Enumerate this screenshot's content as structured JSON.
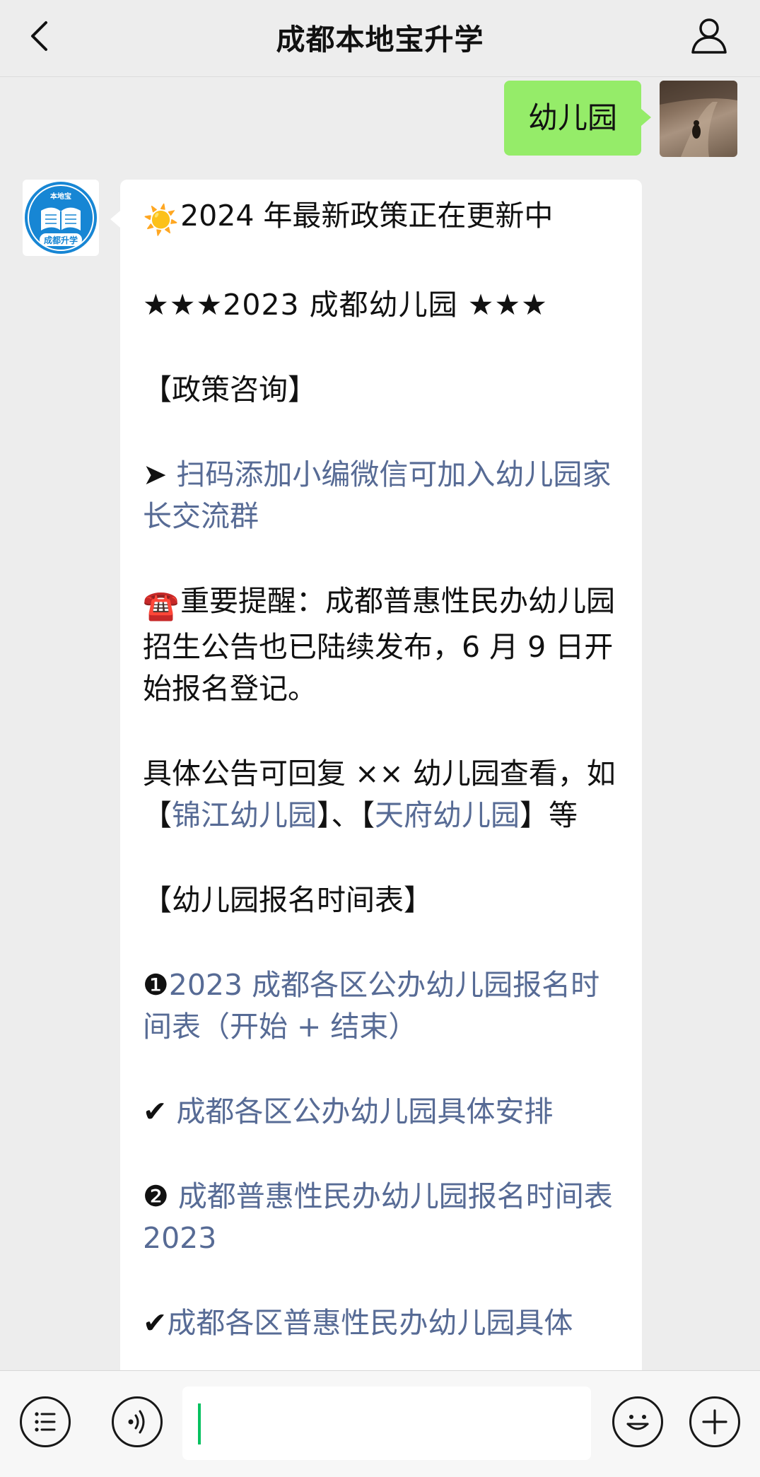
{
  "header": {
    "title": "成都本地宝升学",
    "back_icon": "chevron-left-icon",
    "profile_icon": "person-icon"
  },
  "user_message": {
    "text": "幼儿园"
  },
  "bot": {
    "avatar_top_text": "本地宝",
    "avatar_bottom_text": "成都升学",
    "lines": {
      "l1_emoji": "☀️",
      "l1_text": "2024 年最新政策正在更新中",
      "l2": "★★★2023 成都幼儿园 ★★★",
      "l3": "【政策咨询】",
      "l4_prefix": "➤ ",
      "l4_link": "扫码添加小编微信可加入幼儿园家长交流群",
      "l5_emoji": "☎️",
      "l5_text": "重要提醒：成都普惠性民办幼儿园招生公告也已陆续发布，6 月 9 日开始报名登记。",
      "l6_text": "具体公告可回复 ×× 幼儿园查看，如【",
      "l6_link1": "锦江幼儿园",
      "l6_mid": "】、【",
      "l6_link2": "天府幼儿园",
      "l6_end": "】等",
      "l7": "【幼儿园报名时间表】",
      "l8_badge": "❶",
      "l8_link": "2023 成都各区公办幼儿园报名时间表（开始 + 结束）",
      "l9_check": "✔",
      "l9_link": "成都各区公办幼儿园具体安排",
      "l10_badge": "❷",
      "l10_link": "成都普惠性民办幼儿园报名时间表 2023",
      "l11_check": "✔",
      "l11_link": "成都各区普惠性民办幼儿园具体"
    }
  },
  "bottom_bar": {
    "menu_icon": "list-menu-icon",
    "voice_icon": "voice-icon",
    "input_value": "",
    "emoji_icon": "smiley-icon",
    "plus_icon": "plus-icon"
  },
  "colors": {
    "accent_green": "#95ec69",
    "link_blue": "#576b95",
    "background": "#ededed"
  }
}
